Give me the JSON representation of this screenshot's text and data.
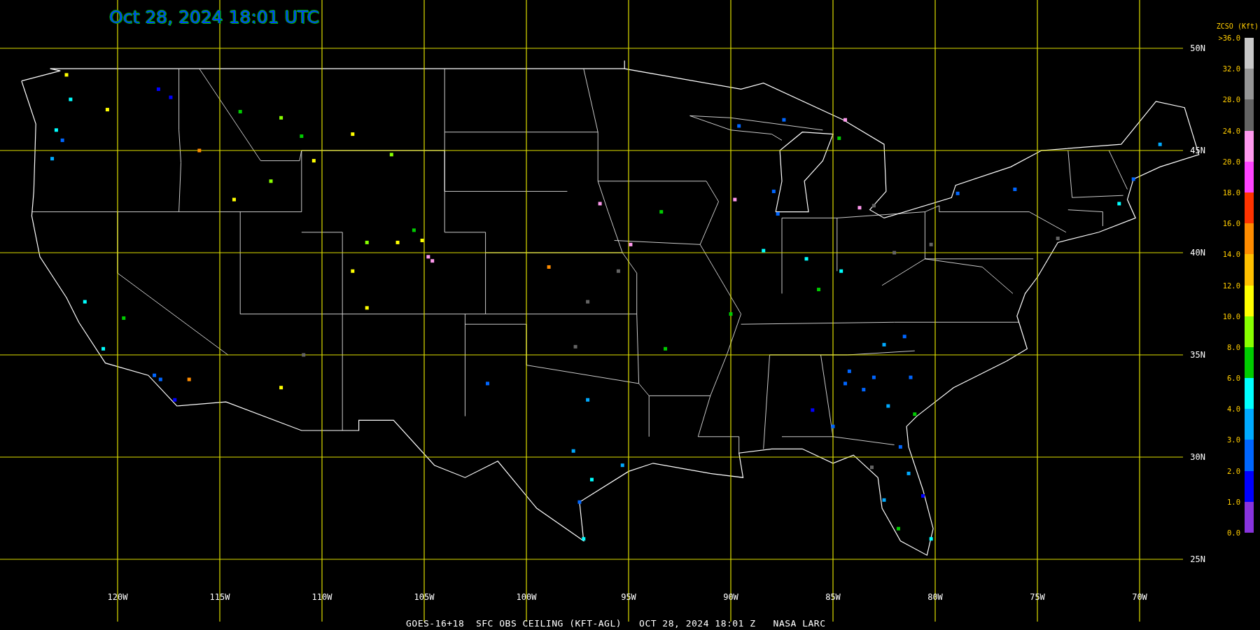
{
  "title": "Oct 28, 2024 18:01 UTC",
  "map": {
    "latitude_labels": [
      "50N",
      "45N",
      "40N",
      "35N",
      "30N",
      "25N"
    ],
    "longitude_labels": [
      "120W",
      "115W",
      "110W",
      "105W",
      "100W",
      "95W",
      "90W",
      "85W",
      "80W",
      "75W",
      "70W"
    ]
  },
  "legend": {
    "title": "ZCSO (Kft)",
    "labels": [
      ">36.0",
      "32.0",
      "28.0",
      "24.0",
      "20.0",
      "18.0",
      "16.0",
      "14.0",
      "12.0",
      "10.0",
      "8.0",
      "6.0",
      "4.0",
      "3.0",
      "2.0",
      "1.0",
      "0.0"
    ],
    "segments": [
      {
        "color": "#c8c8c8"
      },
      {
        "color": "#969696"
      },
      {
        "color": "#646464"
      },
      {
        "color": "#ff99ee"
      },
      {
        "color": "#ff44ff"
      },
      {
        "color": "#ff3300"
      },
      {
        "color": "#ff8c00"
      },
      {
        "color": "#ffc000"
      },
      {
        "color": "#ffff00"
      },
      {
        "color": "#88ff00"
      },
      {
        "color": "#00cc00"
      },
      {
        "color": "#00ffff"
      },
      {
        "color": "#00aaff"
      },
      {
        "color": "#0066ff"
      },
      {
        "color": "#0000ff"
      },
      {
        "color": "#8833dd"
      }
    ]
  },
  "caption": "GOES-16+18  SFC OBS CEILING (KFT-AGL)   OCT 28, 2024 18:01 Z   NASA LARC"
}
